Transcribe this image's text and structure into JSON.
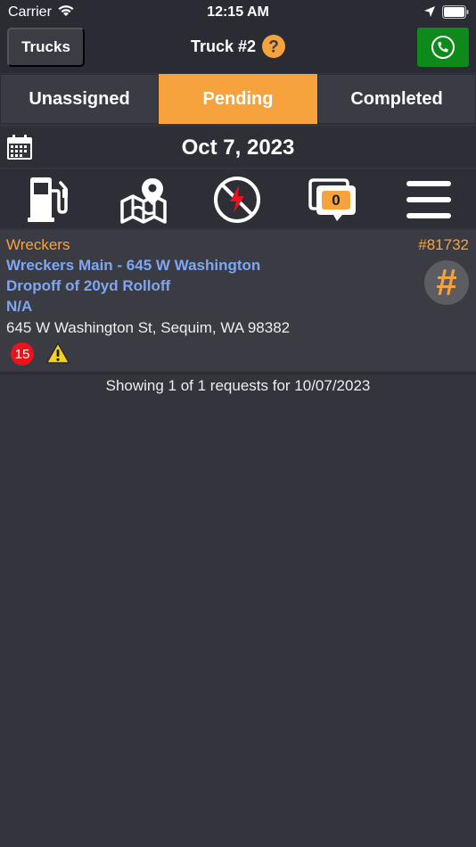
{
  "status_bar": {
    "carrier": "Carrier",
    "time": "12:15 AM"
  },
  "nav": {
    "back_label": "Trucks",
    "title": "Truck #2",
    "help_icon": "help-circle-icon",
    "call_icon": "phone-icon"
  },
  "tabs": [
    {
      "label": "Unassigned",
      "active": false
    },
    {
      "label": "Pending",
      "active": true
    },
    {
      "label": "Completed",
      "active": false
    }
  ],
  "date": {
    "icon": "calendar-icon",
    "label": "Oct 7, 2023"
  },
  "toolbar": {
    "tools": [
      "fuel-pump-icon",
      "map-icon",
      "no-service-icon",
      "messages-icon",
      "menu-icon"
    ],
    "message_count": "0"
  },
  "request": {
    "company": "Wreckers",
    "number": "#81732",
    "location_name": "Wreckers Main - 645 W Washington",
    "task": "Dropoff of 20yd Rolloff",
    "contact": "N/A",
    "address": "645 W Washington St, Sequim, WA 98382",
    "badge_count": "15",
    "hash_symbol": "#"
  },
  "summary": "Showing 1 of 1 requests for 10/07/2023",
  "colors": {
    "background": "#33343c",
    "accent": "#f6a33e",
    "link": "#7fa7f0",
    "call_green": "#0e8a1a",
    "badge_red": "#e8131b"
  }
}
